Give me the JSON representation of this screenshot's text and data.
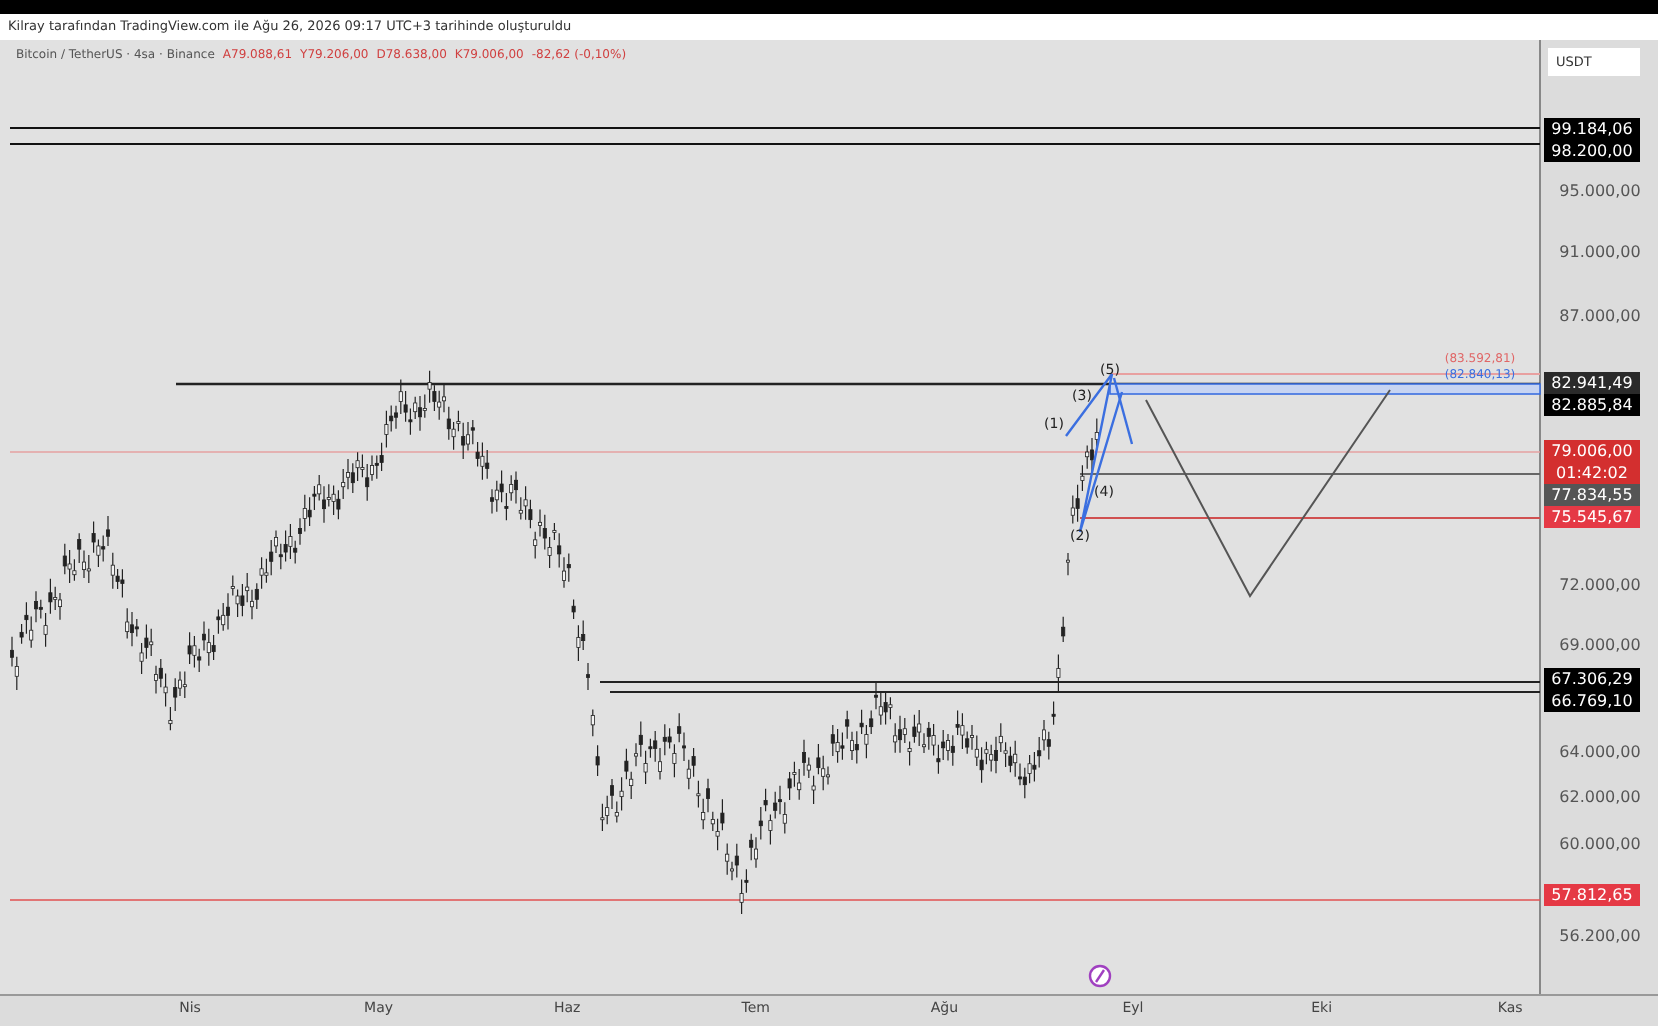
{
  "header": {
    "caption": "Kilray tarafından TradingView.com ile Ağu 26, 2026 09:17 UTC+3 tarihinde oluşturuldu"
  },
  "legend": {
    "symbol": "Bitcoin / TetherUS · 4sa · Binance",
    "values": [
      "A79.088,61",
      "Y79.206,00",
      "D78.638,00",
      "K79.006,00",
      "-82,62 (-0,10%)"
    ]
  },
  "currency": "USDT",
  "y_ticks": [
    "95.000,00",
    "91.000,00",
    "87.000,00",
    "72.000,00",
    "69.000,00",
    "64.000,00",
    "62.000,00",
    "60.000,00",
    "56.200,00"
  ],
  "price_tags": [
    {
      "value": "99.184,06",
      "color": "#000000"
    },
    {
      "value": "98.200,00",
      "color": "#000000"
    },
    {
      "value": "82.941,49",
      "color": "#2a2a2a"
    },
    {
      "value": "82.885,84",
      "color": "#000000"
    },
    {
      "value": "79.006,00",
      "color": "#d32f2f",
      "countdown": "01:42:02"
    },
    {
      "value": "77.834,55",
      "color": "#555555"
    },
    {
      "value": "75.545,67",
      "color": "#e53945"
    },
    {
      "value": "67.306,29",
      "color": "#000000"
    },
    {
      "value": "66.769,10",
      "color": "#000000"
    },
    {
      "value": "57.812,65",
      "color": "#e53945"
    }
  ],
  "level_labels": [
    {
      "text": "(83.592,81)",
      "color": "#e06666"
    },
    {
      "text": "(82.840,13)",
      "color": "#3b6fe0"
    }
  ],
  "wave_labels": [
    "(1)",
    "(2)",
    "(3)",
    "(4)",
    "(5)"
  ],
  "x_labels": [
    "Nis",
    "May",
    "Haz",
    "Tem",
    "Ağu",
    "Eyl",
    "Eki",
    "Kas"
  ]
}
